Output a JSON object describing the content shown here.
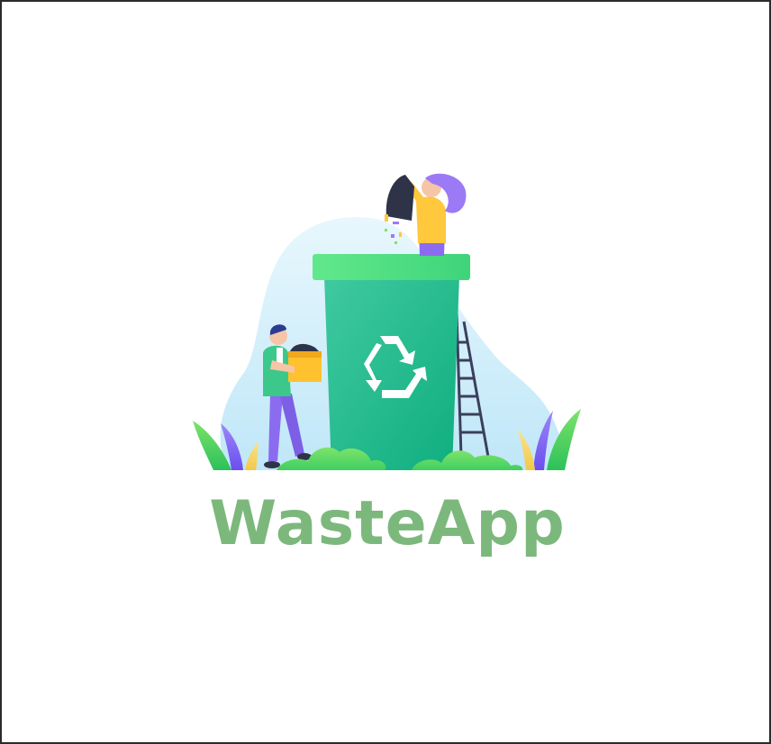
{
  "app": {
    "title": "WasteApp"
  },
  "splash": {
    "illustration_icon": "recycle-icon",
    "colors": {
      "title": "#7cb87c",
      "bin_body": "#1fb98a",
      "bin_lid": "#55e08a",
      "backdrop": "#d6f0fb",
      "person_shirt_yellow": "#ffc83d",
      "person_pants_purple": "#8b6cf0",
      "hair_purple": "#9c7af5",
      "vest_green": "#3cc88a",
      "box_yellow": "#ffc12e",
      "leaf_green": "#4ad35f",
      "leaf_purple": "#7b5cf0",
      "leaf_yellow": "#f7d56a"
    }
  }
}
